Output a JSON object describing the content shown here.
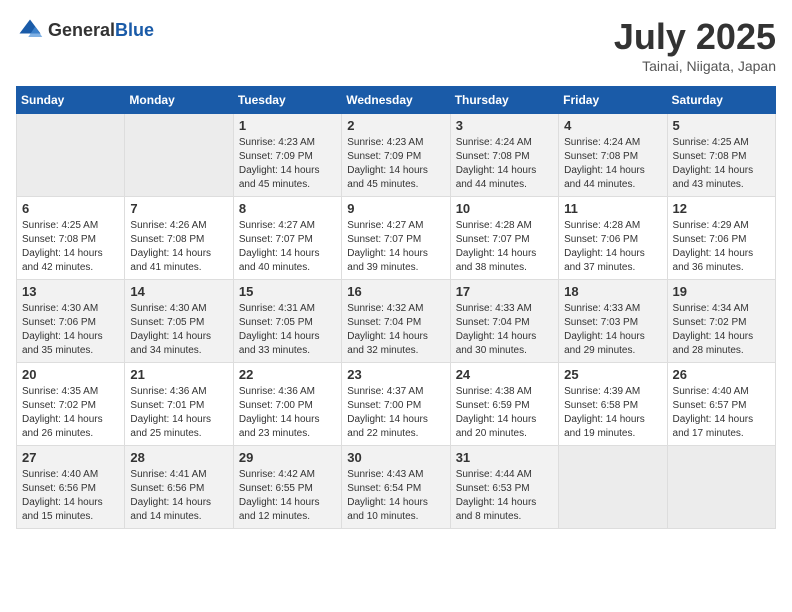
{
  "logo": {
    "general": "General",
    "blue": "Blue"
  },
  "header": {
    "title": "July 2025",
    "location": "Tainai, Niigata, Japan"
  },
  "weekdays": [
    "Sunday",
    "Monday",
    "Tuesday",
    "Wednesday",
    "Thursday",
    "Friday",
    "Saturday"
  ],
  "weeks": [
    [
      {
        "day": "",
        "sunrise": "",
        "sunset": "",
        "daylight": ""
      },
      {
        "day": "",
        "sunrise": "",
        "sunset": "",
        "daylight": ""
      },
      {
        "day": "1",
        "sunrise": "Sunrise: 4:23 AM",
        "sunset": "Sunset: 7:09 PM",
        "daylight": "Daylight: 14 hours and 45 minutes."
      },
      {
        "day": "2",
        "sunrise": "Sunrise: 4:23 AM",
        "sunset": "Sunset: 7:09 PM",
        "daylight": "Daylight: 14 hours and 45 minutes."
      },
      {
        "day": "3",
        "sunrise": "Sunrise: 4:24 AM",
        "sunset": "Sunset: 7:08 PM",
        "daylight": "Daylight: 14 hours and 44 minutes."
      },
      {
        "day": "4",
        "sunrise": "Sunrise: 4:24 AM",
        "sunset": "Sunset: 7:08 PM",
        "daylight": "Daylight: 14 hours and 44 minutes."
      },
      {
        "day": "5",
        "sunrise": "Sunrise: 4:25 AM",
        "sunset": "Sunset: 7:08 PM",
        "daylight": "Daylight: 14 hours and 43 minutes."
      }
    ],
    [
      {
        "day": "6",
        "sunrise": "Sunrise: 4:25 AM",
        "sunset": "Sunset: 7:08 PM",
        "daylight": "Daylight: 14 hours and 42 minutes."
      },
      {
        "day": "7",
        "sunrise": "Sunrise: 4:26 AM",
        "sunset": "Sunset: 7:08 PM",
        "daylight": "Daylight: 14 hours and 41 minutes."
      },
      {
        "day": "8",
        "sunrise": "Sunrise: 4:27 AM",
        "sunset": "Sunset: 7:07 PM",
        "daylight": "Daylight: 14 hours and 40 minutes."
      },
      {
        "day": "9",
        "sunrise": "Sunrise: 4:27 AM",
        "sunset": "Sunset: 7:07 PM",
        "daylight": "Daylight: 14 hours and 39 minutes."
      },
      {
        "day": "10",
        "sunrise": "Sunrise: 4:28 AM",
        "sunset": "Sunset: 7:07 PM",
        "daylight": "Daylight: 14 hours and 38 minutes."
      },
      {
        "day": "11",
        "sunrise": "Sunrise: 4:28 AM",
        "sunset": "Sunset: 7:06 PM",
        "daylight": "Daylight: 14 hours and 37 minutes."
      },
      {
        "day": "12",
        "sunrise": "Sunrise: 4:29 AM",
        "sunset": "Sunset: 7:06 PM",
        "daylight": "Daylight: 14 hours and 36 minutes."
      }
    ],
    [
      {
        "day": "13",
        "sunrise": "Sunrise: 4:30 AM",
        "sunset": "Sunset: 7:06 PM",
        "daylight": "Daylight: 14 hours and 35 minutes."
      },
      {
        "day": "14",
        "sunrise": "Sunrise: 4:30 AM",
        "sunset": "Sunset: 7:05 PM",
        "daylight": "Daylight: 14 hours and 34 minutes."
      },
      {
        "day": "15",
        "sunrise": "Sunrise: 4:31 AM",
        "sunset": "Sunset: 7:05 PM",
        "daylight": "Daylight: 14 hours and 33 minutes."
      },
      {
        "day": "16",
        "sunrise": "Sunrise: 4:32 AM",
        "sunset": "Sunset: 7:04 PM",
        "daylight": "Daylight: 14 hours and 32 minutes."
      },
      {
        "day": "17",
        "sunrise": "Sunrise: 4:33 AM",
        "sunset": "Sunset: 7:04 PM",
        "daylight": "Daylight: 14 hours and 30 minutes."
      },
      {
        "day": "18",
        "sunrise": "Sunrise: 4:33 AM",
        "sunset": "Sunset: 7:03 PM",
        "daylight": "Daylight: 14 hours and 29 minutes."
      },
      {
        "day": "19",
        "sunrise": "Sunrise: 4:34 AM",
        "sunset": "Sunset: 7:02 PM",
        "daylight": "Daylight: 14 hours and 28 minutes."
      }
    ],
    [
      {
        "day": "20",
        "sunrise": "Sunrise: 4:35 AM",
        "sunset": "Sunset: 7:02 PM",
        "daylight": "Daylight: 14 hours and 26 minutes."
      },
      {
        "day": "21",
        "sunrise": "Sunrise: 4:36 AM",
        "sunset": "Sunset: 7:01 PM",
        "daylight": "Daylight: 14 hours and 25 minutes."
      },
      {
        "day": "22",
        "sunrise": "Sunrise: 4:36 AM",
        "sunset": "Sunset: 7:00 PM",
        "daylight": "Daylight: 14 hours and 23 minutes."
      },
      {
        "day": "23",
        "sunrise": "Sunrise: 4:37 AM",
        "sunset": "Sunset: 7:00 PM",
        "daylight": "Daylight: 14 hours and 22 minutes."
      },
      {
        "day": "24",
        "sunrise": "Sunrise: 4:38 AM",
        "sunset": "Sunset: 6:59 PM",
        "daylight": "Daylight: 14 hours and 20 minutes."
      },
      {
        "day": "25",
        "sunrise": "Sunrise: 4:39 AM",
        "sunset": "Sunset: 6:58 PM",
        "daylight": "Daylight: 14 hours and 19 minutes."
      },
      {
        "day": "26",
        "sunrise": "Sunrise: 4:40 AM",
        "sunset": "Sunset: 6:57 PM",
        "daylight": "Daylight: 14 hours and 17 minutes."
      }
    ],
    [
      {
        "day": "27",
        "sunrise": "Sunrise: 4:40 AM",
        "sunset": "Sunset: 6:56 PM",
        "daylight": "Daylight: 14 hours and 15 minutes."
      },
      {
        "day": "28",
        "sunrise": "Sunrise: 4:41 AM",
        "sunset": "Sunset: 6:56 PM",
        "daylight": "Daylight: 14 hours and 14 minutes."
      },
      {
        "day": "29",
        "sunrise": "Sunrise: 4:42 AM",
        "sunset": "Sunset: 6:55 PM",
        "daylight": "Daylight: 14 hours and 12 minutes."
      },
      {
        "day": "30",
        "sunrise": "Sunrise: 4:43 AM",
        "sunset": "Sunset: 6:54 PM",
        "daylight": "Daylight: 14 hours and 10 minutes."
      },
      {
        "day": "31",
        "sunrise": "Sunrise: 4:44 AM",
        "sunset": "Sunset: 6:53 PM",
        "daylight": "Daylight: 14 hours and 8 minutes."
      },
      {
        "day": "",
        "sunrise": "",
        "sunset": "",
        "daylight": ""
      },
      {
        "day": "",
        "sunrise": "",
        "sunset": "",
        "daylight": ""
      }
    ]
  ]
}
